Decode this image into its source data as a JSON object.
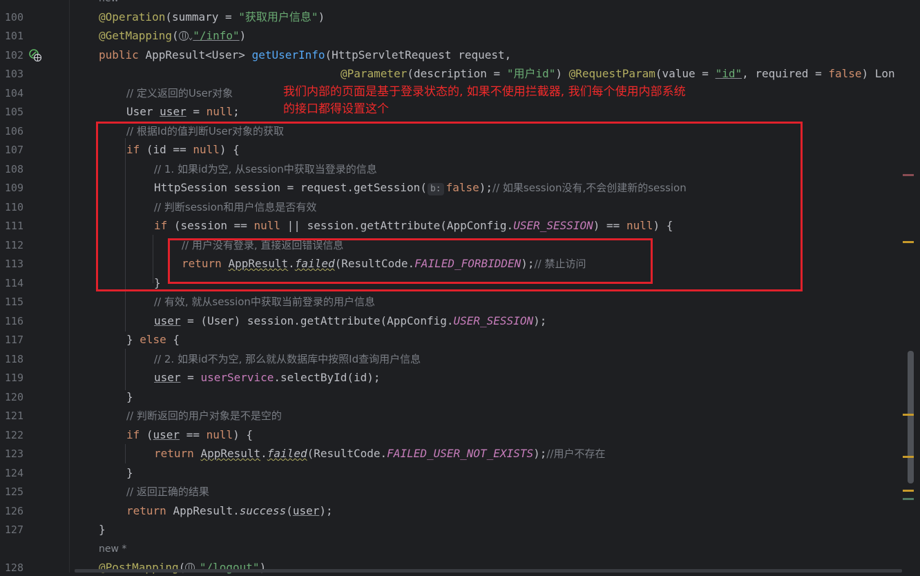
{
  "annotation_note": {
    "line1": "我们内部的页面是基于登录状态的, 如果不使用拦截器, 我们每个使用内部系统",
    "line2": "的接口都得设置这个"
  },
  "hints": {
    "top_new": "new",
    "new_star": "new *",
    "param_hint": "b:"
  },
  "lines": {
    "l100": {
      "num": "100",
      "ann": "@Operation",
      "p1": "(summary = ",
      "str": "\"获取用户信息\"",
      "p2": ")"
    },
    "l101": {
      "num": "101",
      "ann": "@GetMapping",
      "p1": "(",
      "str": "\"/info\"",
      "p2": ")"
    },
    "l102": {
      "num": "102",
      "kw": "public ",
      "p1": "AppResult<User> ",
      "fn": "getUserInfo",
      "p2": "(HttpServletRequest request,"
    },
    "l103": {
      "num": "103",
      "ann1": "@Parameter",
      "p1": "(description = ",
      "str1": "\"用户id\"",
      "p2": ") ",
      "ann2": "@RequestParam",
      "p3": "(value = ",
      "str2": "\"id\"",
      "p4": ", required = ",
      "kw": "false",
      "p5": ") Lon"
    },
    "l104": {
      "num": "104",
      "cm": "// 定义返回的User对象"
    },
    "l105": {
      "num": "105",
      "p1": "User ",
      "var": "user",
      "p2": " = ",
      "kw": "null",
      "p3": ";"
    },
    "l106": {
      "num": "106",
      "cm": "// 根据Id的值判断User对象的获取"
    },
    "l107": {
      "num": "107",
      "kw1": "if",
      "p1": " (id == ",
      "kw2": "null",
      "p2": ") {"
    },
    "l108": {
      "num": "108",
      "cm": "// 1. 如果id为空, 从session中获取当登录的信息"
    },
    "l109": {
      "num": "109",
      "p1": "HttpSession session = request.getSession(",
      "kw": "false",
      "p2": ");",
      "cm": "// 如果session没有,不会创建新的session"
    },
    "l110": {
      "num": "110",
      "cm": "// 判断session和用户信息是否有效"
    },
    "l111": {
      "num": "111",
      "kw1": "if",
      "p1": " (session == ",
      "kw2": "null",
      "p2": " || session.getAttribute(AppConfig.",
      "fld": "USER_SESSION",
      "p3": ") == ",
      "kw3": "null",
      "p4": ") {"
    },
    "l112": {
      "num": "112",
      "cm": "// 用户没有登录, 直接返回错误信息"
    },
    "l113": {
      "num": "113",
      "kw": "return ",
      "cls": "AppResult",
      "p1": ".",
      "mth": "failed",
      "p2": "(ResultCode.",
      "fld": "FAILED_FORBIDDEN",
      "p3": ");",
      "cm": "// 禁止访问"
    },
    "l114": {
      "num": "114",
      "p1": "}"
    },
    "l115": {
      "num": "115",
      "cm": "// 有效, 就从session中获取当前登录的用户信息"
    },
    "l116": {
      "num": "116",
      "var": "user",
      "p1": " = (User) session.getAttribute(AppConfig.",
      "fld": "USER_SESSION",
      "p2": ");"
    },
    "l117": {
      "num": "117",
      "p1": "} ",
      "kw": "else",
      "p2": " {"
    },
    "l118": {
      "num": "118",
      "cm": "// 2. 如果id不为空, 那么就从数据库中按照Id查询用户信息"
    },
    "l119": {
      "num": "119",
      "var": "user",
      "p1": " = ",
      "svc": "userService",
      "p2": ".selectById(id);"
    },
    "l120": {
      "num": "120",
      "p1": "}"
    },
    "l121": {
      "num": "121",
      "cm": "// 判断返回的用户对象是不是空的"
    },
    "l122": {
      "num": "122",
      "kw1": "if",
      "p1": " (",
      "var": "user",
      "p2": " == ",
      "kw2": "null",
      "p3": ") {"
    },
    "l123": {
      "num": "123",
      "kw": "return ",
      "cls": "AppResult",
      "p1": ".",
      "mth": "failed",
      "p2": "(ResultCode.",
      "fld": "FAILED_USER_NOT_EXISTS",
      "p3": ");",
      "cm": "//用户不存在"
    },
    "l124": {
      "num": "124",
      "p1": "}"
    },
    "l125": {
      "num": "125",
      "cm": "// 返回正确的结果"
    },
    "l126": {
      "num": "126",
      "kw": "return ",
      "p1": "AppResult.",
      "mth": "success",
      "p2": "(",
      "var": "user",
      "p3": ");"
    },
    "l127": {
      "num": "127",
      "p1": "}"
    },
    "l128": {
      "num": "128",
      "ann": "@PostMapping",
      "p1": "(",
      "str": "\"/logout\"",
      "p2": ")"
    }
  },
  "colors": {
    "background": "#1e1f22",
    "annotation_red": "#e0212b",
    "keyword": "#cf8e6d",
    "annotation": "#b3ae60",
    "string": "#6aab73",
    "comment": "#7a7e85"
  }
}
